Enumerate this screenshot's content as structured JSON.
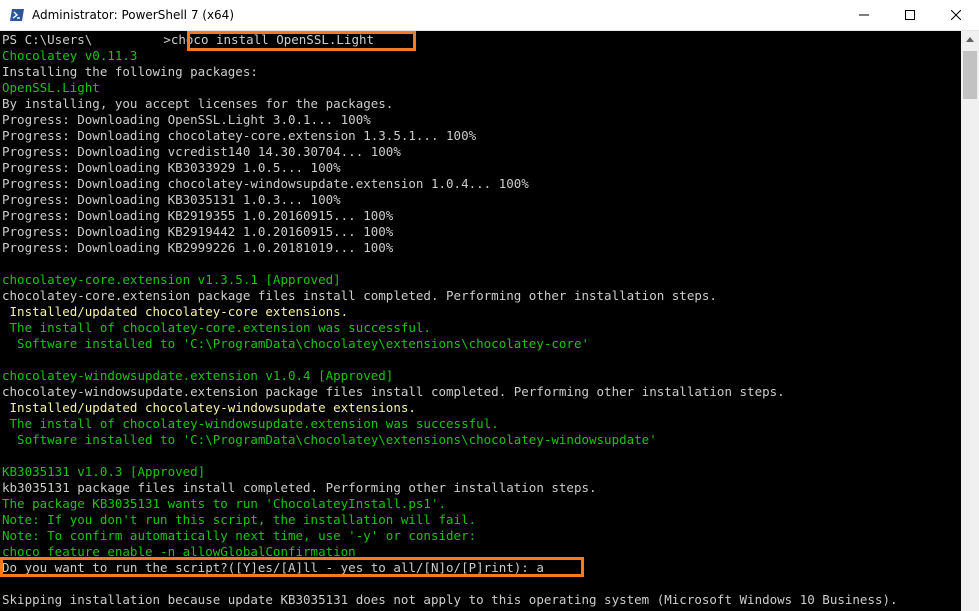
{
  "window": {
    "title": "Administrator: PowerShell 7 (x64)",
    "icon": "powershell-icon",
    "controls": [
      "minimize-icon",
      "maximize-icon",
      "close-icon"
    ]
  },
  "console": {
    "prompt_prefix": "PS C:\\Users\\",
    "prompt_suffix": ">",
    "command": "choco install OpenSSL.Light",
    "lines": [
      "Chocolatey v0.11.3",
      "Installing the following packages:",
      "OpenSSL.Light",
      "By installing, you accept licenses for the packages.",
      "Progress: Downloading OpenSSL.Light 3.0.1... 100%",
      "Progress: Downloading chocolatey-core.extension 1.3.5.1... 100%",
      "Progress: Downloading vcredist140 14.30.30704... 100%",
      "Progress: Downloading KB3033929 1.0.5... 100%",
      "Progress: Downloading chocolatey-windowsupdate.extension 1.0.4... 100%",
      "Progress: Downloading KB3035131 1.0.3... 100%",
      "Progress: Downloading KB2919355 1.0.20160915... 100%",
      "Progress: Downloading KB2919442 1.0.20160915... 100%",
      "Progress: Downloading KB2999226 1.0.20181019... 100%",
      "",
      "chocolatey-core.extension v1.3.5.1 [Approved]",
      "chocolatey-core.extension package files install completed. Performing other installation steps.",
      " Installed/updated chocolatey-core extensions.",
      " The install of chocolatey-core.extension was successful.",
      "  Software installed to 'C:\\ProgramData\\chocolatey\\extensions\\chocolatey-core'",
      "",
      "chocolatey-windowsupdate.extension v1.0.4 [Approved]",
      "chocolatey-windowsupdate.extension package files install completed. Performing other installation steps.",
      " Installed/updated chocolatey-windowsupdate extensions.",
      " The install of chocolatey-windowsupdate.extension was successful.",
      "  Software installed to 'C:\\ProgramData\\chocolatey\\extensions\\chocolatey-windowsupdate'",
      "",
      "KB3035131 v1.0.3 [Approved]",
      "kb3035131 package files install completed. Performing other installation steps.",
      "The package KB3035131 wants to run 'ChocolateyInstall.ps1'.",
      "Note: If you don't run this script, the installation will fail.",
      "Note: To confirm automatically next time, use '-y' or consider:",
      "choco feature enable -n allowGlobalConfirmation",
      "Do you want to run the script?([Y]es/[A]ll - yes to all/[N]o/[P]rint): a",
      "",
      "Skipping installation because update KB3035131 does not apply to this operating system (Microsoft Windows 10 Business)."
    ],
    "line_colors": [
      "green",
      "gray",
      "green",
      "gray",
      "gray",
      "gray",
      "gray",
      "gray",
      "gray",
      "gray",
      "gray",
      "gray",
      "gray",
      "gray",
      "green",
      "gray",
      "yellow",
      "green",
      "green",
      "gray",
      "green",
      "gray",
      "yellow",
      "green",
      "green",
      "gray",
      "green",
      "gray",
      "green",
      "green",
      "green",
      "green",
      "gray",
      "gray",
      "gray"
    ]
  },
  "colors": {
    "background": "#000000",
    "text": "#cccccc",
    "green": "#16c60c",
    "yellow": "#f9f1a5",
    "highlight": "#f47b20"
  }
}
